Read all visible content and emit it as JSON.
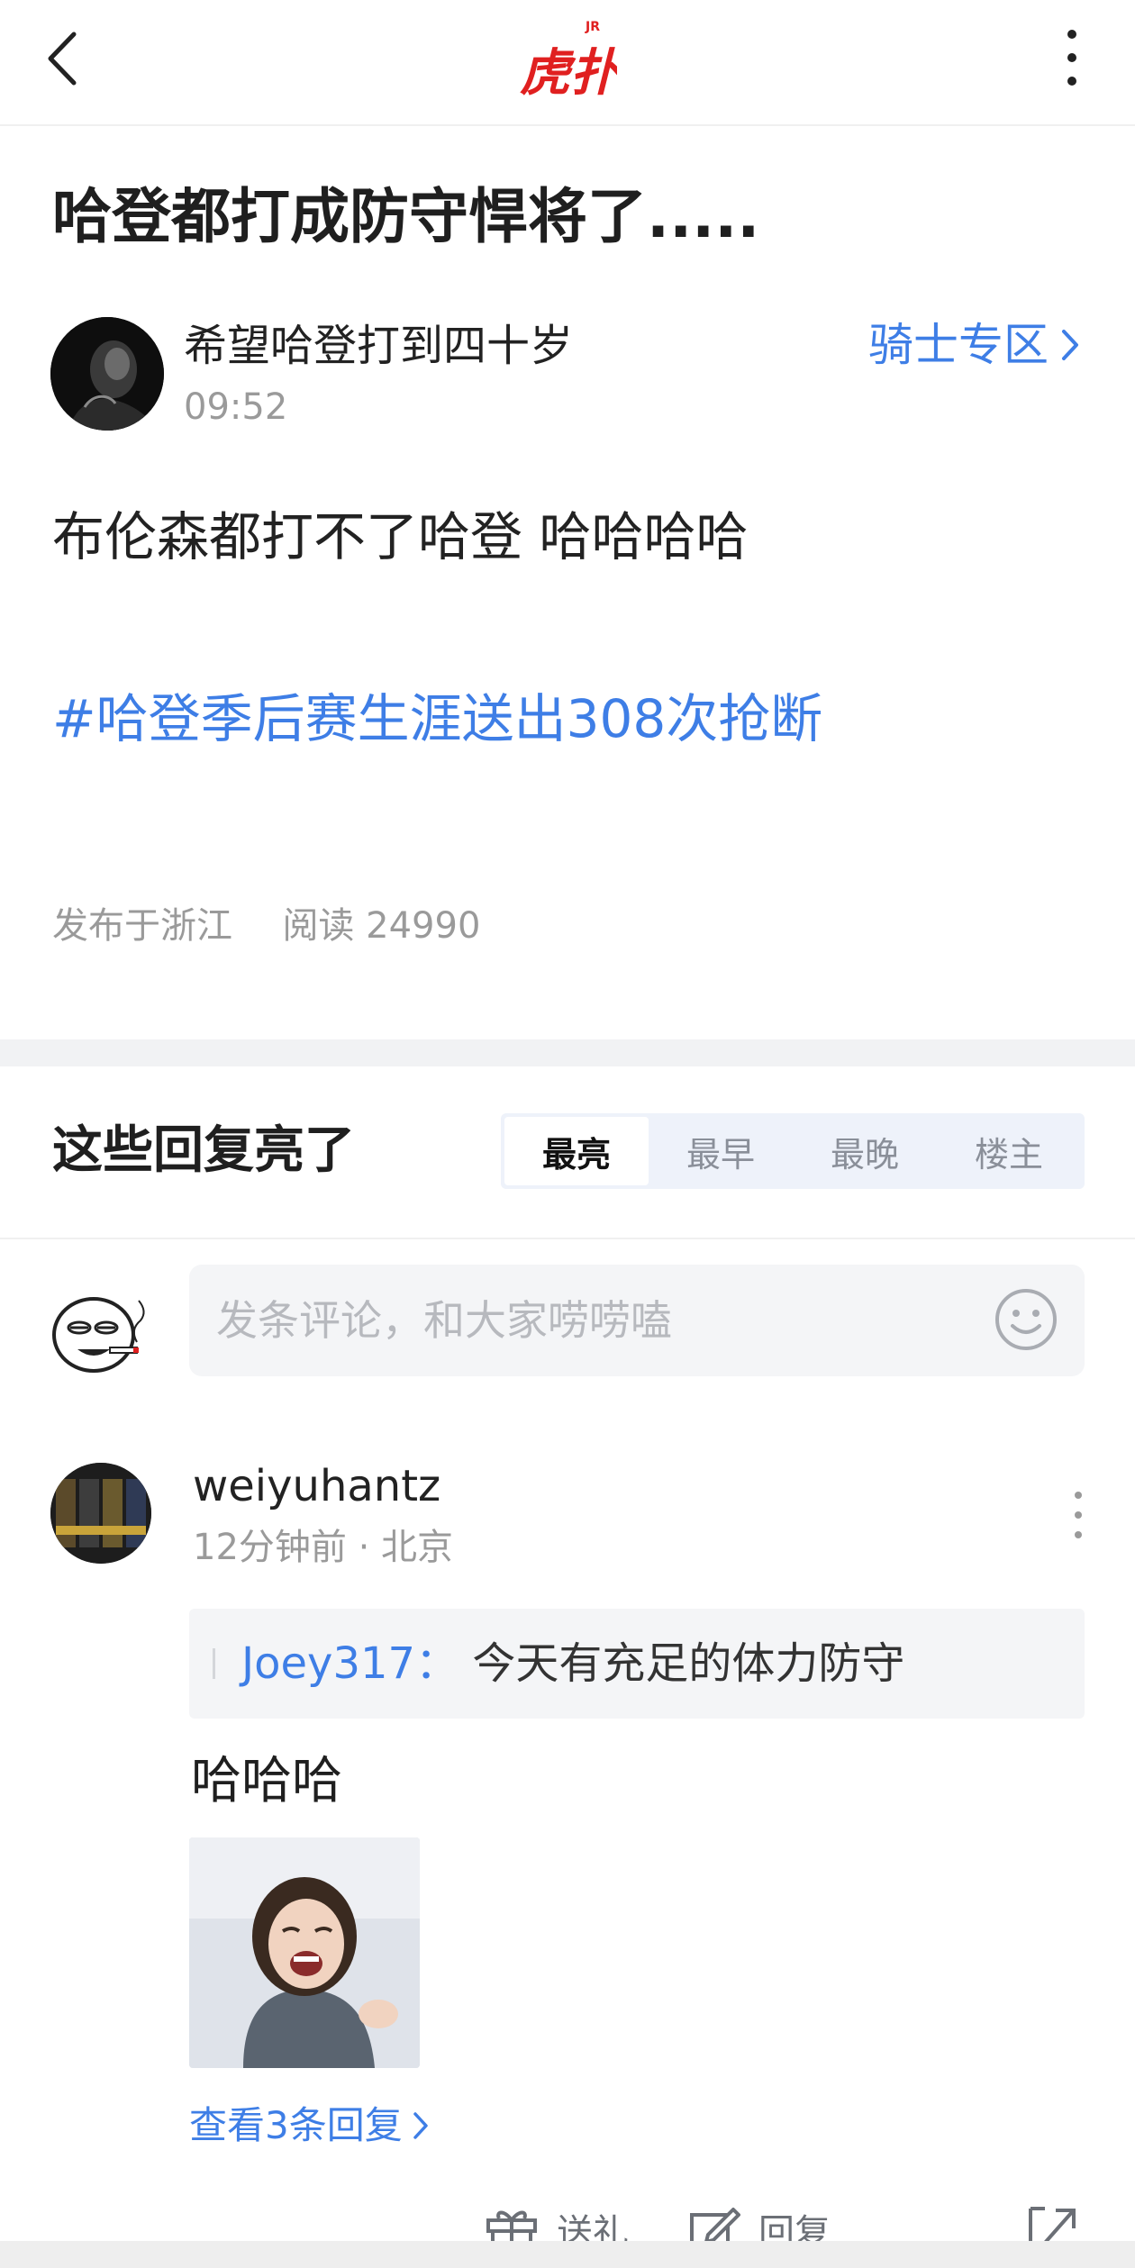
{
  "header": {
    "logo_text": "虎扑",
    "logo_badge": "JR"
  },
  "post": {
    "title": "哈登都打成防守悍将了.....",
    "author": "希望哈登打到四十岁",
    "time": "09:52",
    "zone": "骑士专区",
    "body": "布伦森都打不了哈登 哈哈哈哈",
    "hashtag": "#哈登季后赛生涯送出308次抢断",
    "location": "发布于浙江",
    "reads": "阅读 24990"
  },
  "replies": {
    "heading": "这些回复亮了",
    "tabs": [
      "最亮",
      "最早",
      "最晚",
      "楼主"
    ],
    "active_tab": "最亮",
    "comment_placeholder": "发条评论，和大家唠唠嗑"
  },
  "reply": {
    "user": "weiyuhantz",
    "time": "12分钟前 · 北京",
    "quote_author": "Joey317：",
    "quote_text": "今天有充足的体力防守",
    "text": "哈哈哈",
    "view_more": "查看3条回复"
  },
  "bottom_bar": {
    "gift": "送礼",
    "reply": "回复"
  },
  "colors": {
    "accent_blue": "#3e7ee6",
    "logo_red": "#e02020",
    "muted_gray": "#9a9a9a"
  }
}
